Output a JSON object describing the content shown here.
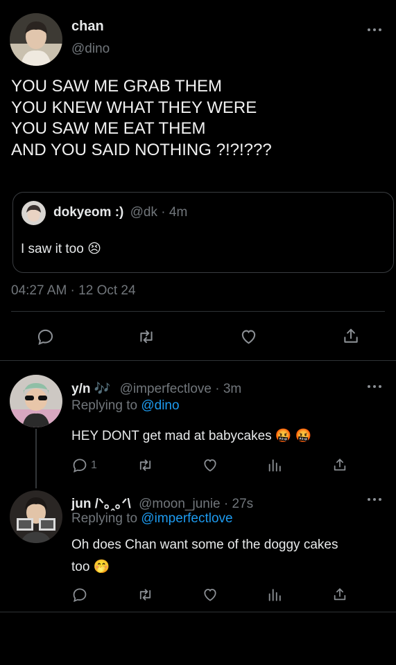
{
  "main_tweet": {
    "display_name": "chan",
    "handle": "@dino",
    "text_lines": [
      "YOU SAW ME GRAB THEM",
      "YOU KNEW WHAT THEY WERE",
      "YOU SAW ME EAT THEM",
      "AND YOU SAID NOTHING ?!?!???"
    ],
    "quoted": {
      "display_name": "dokyeom :)",
      "handle": "@dk",
      "time": "· 4m",
      "text": "I saw it too 😣"
    },
    "timestamp": "04:27 AM · 12 Oct 24"
  },
  "replies": [
    {
      "display_name": "y/n 🎶",
      "handle": "@imperfectlove",
      "time": "· 3m",
      "replying_prefix": "Replying to",
      "replying_to": "@dino",
      "text": "HEY DONT get mad at babycakes 🤬 🤬",
      "reply_count": "1"
    },
    {
      "display_name": "jun /ᐠ｡ꞈ｡ᐟ\\",
      "handle": "@moon_junie",
      "time": "· 27s",
      "replying_prefix": "Replying to",
      "replying_to": "@imperfectlove",
      "text_line1": "Oh does Chan want some of the doggy cakes",
      "text_line2": "too 🤭",
      "reply_count": ""
    }
  ],
  "icons": [
    "reply-icon",
    "retweet-icon",
    "like-icon",
    "share-icon",
    "analytics-icon",
    "more-icon"
  ],
  "colors": {
    "background": "#000000",
    "text": "#e7e9ea",
    "muted": "#71767b",
    "link": "#1d9bf0",
    "border": "#2f3336"
  }
}
